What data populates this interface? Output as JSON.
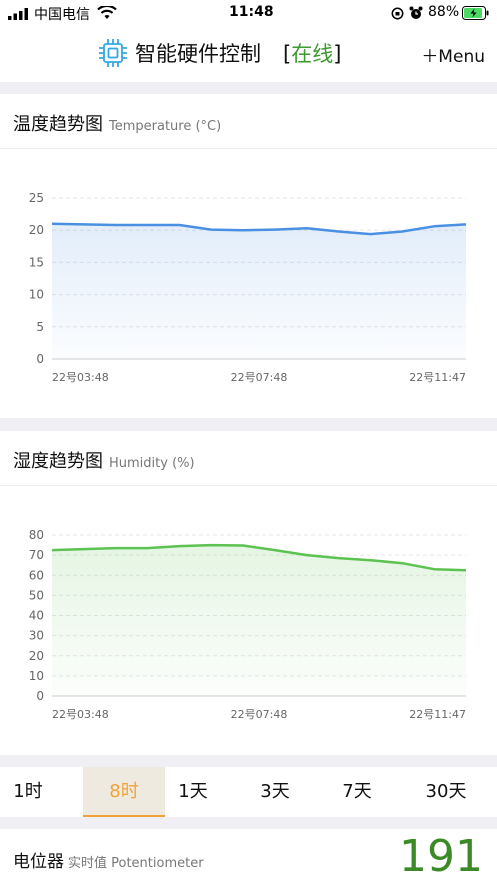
{
  "status_bar": {
    "carrier": "中国电信",
    "time": "11:48",
    "battery": "88%",
    "icons": [
      "signal-icon",
      "wifi-icon",
      "rotation-lock-icon",
      "alarm-icon",
      "battery-charging-icon"
    ]
  },
  "header": {
    "title": "智能硬件控制",
    "state_open": "[",
    "state": "在线",
    "state_close": "]",
    "menu_label": "＋Menu",
    "logo_icon": "chip-icon",
    "colors": {
      "online": "#3c9a2e"
    }
  },
  "temperature": {
    "title": "温度趋势图",
    "subtitle": "Temperature (°C)"
  },
  "humidity": {
    "title": "湿度趋势图",
    "subtitle": "Humidity (%)"
  },
  "chart_data": [
    {
      "type": "area",
      "x": [
        "22号03:48",
        "22号04:48",
        "22号05:48",
        "22号06:48",
        "22号07:48",
        "22号08:18",
        "22号08:48",
        "22号09:18",
        "22号09:48",
        "22号10:18",
        "22号10:33",
        "22号10:48",
        "22号11:18",
        "22号11:47"
      ],
      "series": [
        {
          "values": [
            21,
            20.9,
            20.8,
            20.8,
            20.8,
            20.1,
            20,
            20.1,
            20.3,
            19.8,
            19.4,
            19.8,
            20.6,
            20.9
          ],
          "color": "#4a90e2"
        }
      ],
      "xticks": [
        "22号03:48",
        "22号07:48",
        "22号11:47"
      ],
      "yticks": [
        0,
        5,
        10,
        15,
        20,
        25
      ],
      "ylim": [
        0,
        25
      ],
      "grid": true
    },
    {
      "type": "area",
      "x": [
        "22号03:48",
        "22号04:48",
        "22号05:48",
        "22号06:48",
        "22号07:18",
        "22号07:48",
        "22号08:18",
        "22号08:48",
        "22号09:18",
        "22号09:48",
        "22号10:18",
        "22号10:48",
        "22号11:18",
        "22号11:47"
      ],
      "series": [
        {
          "values": [
            72.5,
            73,
            73.5,
            73.5,
            74.5,
            75,
            74.8,
            72.5,
            70,
            68.5,
            67.5,
            66,
            63,
            62.5
          ],
          "color": "#5cc251"
        }
      ],
      "xticks": [
        "22号03:48",
        "22号07:48",
        "22号11:47"
      ],
      "yticks": [
        0,
        10,
        20,
        30,
        40,
        50,
        60,
        70,
        80
      ],
      "ylim": [
        0,
        80
      ],
      "grid": true
    }
  ],
  "tabs": [
    {
      "label": "1时"
    },
    {
      "label": "8时",
      "active": true
    },
    {
      "label": "1天"
    },
    {
      "label": "3天"
    },
    {
      "label": "7天"
    },
    {
      "label": "30天"
    }
  ],
  "potentiometer": {
    "label": "电位器",
    "sub": "实时值 Potentiometer",
    "value": "191",
    "color": "#3c8a27"
  }
}
